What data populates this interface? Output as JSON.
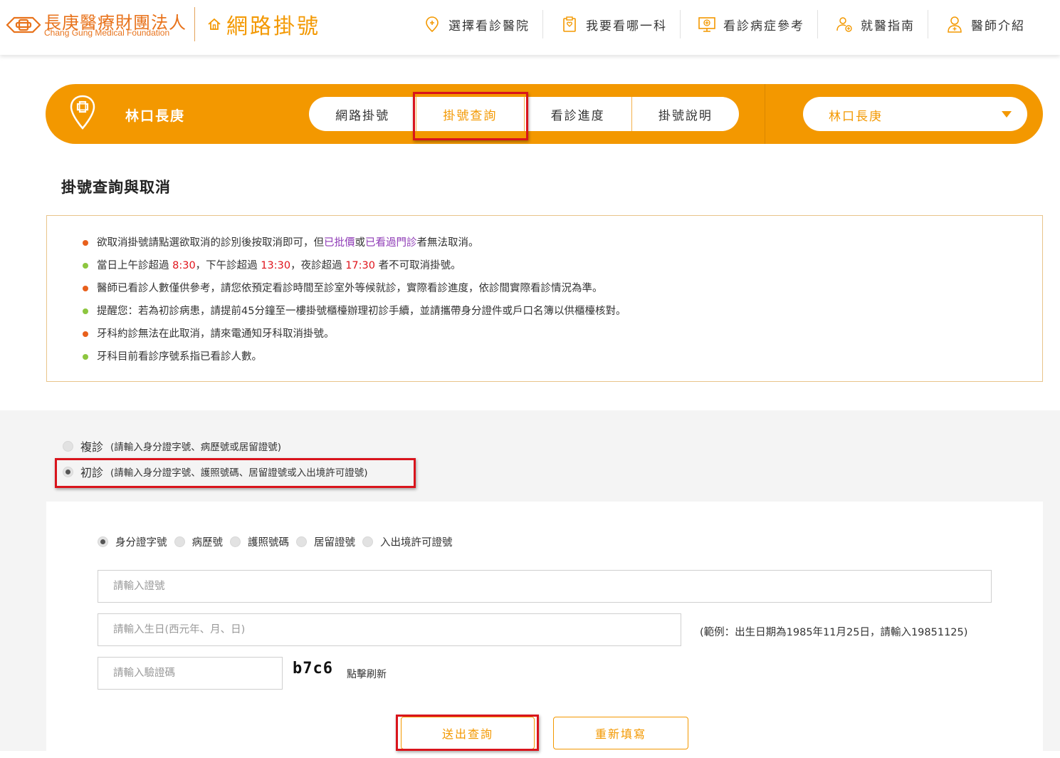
{
  "header": {
    "logo_cn": "長庚醫療財團法人",
    "logo_en": "Chang Gung Medical Foundation",
    "app_title": "網路掛號",
    "nav": [
      {
        "label": "選擇看診醫院",
        "icon": "location-pin-icon"
      },
      {
        "label": "我要看哪一科",
        "icon": "clipboard-icon"
      },
      {
        "label": "看診病症參考",
        "icon": "monitor-medical-icon"
      },
      {
        "label": "就醫指南",
        "icon": "person-guide-icon"
      },
      {
        "label": "醫師介紹",
        "icon": "doctor-icon"
      }
    ]
  },
  "hospital_bar": {
    "hospital_name": "林口長庚",
    "tabs": [
      "網路掛號",
      "掛號查詢",
      "看診進度",
      "掛號說明"
    ],
    "active_tab": "掛號查詢",
    "select_value": "林口長庚"
  },
  "page_title": "掛號查詢與取消",
  "notice": [
    {
      "parts": [
        "欲取消掛號請點選欲取消的診別後按取消即可，但",
        "已批價",
        "或",
        "已看過門診",
        "者無法取消。"
      ]
    },
    {
      "parts": [
        "當日上午診超過 ",
        "8:30",
        "，下午診超過 ",
        "13:30",
        "，夜診超過 ",
        "17:30",
        " 者不可取消掛號。"
      ]
    },
    {
      "text": "醫師已看診人數僅供參考，請您依預定看診時間至診室外等候就診，實際看診進度，依診間實際看診情況為準。"
    },
    {
      "text": "提醒您：若為初診病患，請提前45分鐘至一樓掛號櫃檯辦理初診手續，並請攜帶身分證件或戶口名簿以供櫃檯核對。"
    },
    {
      "text": "牙科約診無法在此取消，請來電通知牙科取消掛號。"
    },
    {
      "text": "牙科目前看診序號系指已看診人數。"
    }
  ],
  "visit_type": {
    "options": [
      {
        "name": "複診",
        "desc": "(請輸入身分證字號、病歷號或居留證號)",
        "checked": false
      },
      {
        "name": "初診",
        "desc": "(請輸入身分證字號、護照號碼、居留證號或入出境許可證號)",
        "checked": true
      }
    ]
  },
  "id_types": [
    {
      "label": "身分證字號",
      "checked": true
    },
    {
      "label": "病歷號",
      "checked": false
    },
    {
      "label": "護照號碼",
      "checked": false
    },
    {
      "label": "居留證號",
      "checked": false
    },
    {
      "label": "入出境許可證號",
      "checked": false
    }
  ],
  "form": {
    "id_placeholder": "請輸入證號",
    "birth_placeholder": "請輸入生日(西元年、月、日)",
    "birth_example": "(範例：出生日期為1985年11月25日，請輸入19851125)",
    "captcha_placeholder": "請輸入驗證碼",
    "captcha_code": "b7c6",
    "refresh_label": "點擊刷新",
    "submit_label": "送出查詢",
    "reset_label": "重新填寫"
  },
  "colors": {
    "accent": "#f39800",
    "highlight": "#d9141c",
    "purple": "#8e3ab6",
    "red": "#e0141c"
  }
}
